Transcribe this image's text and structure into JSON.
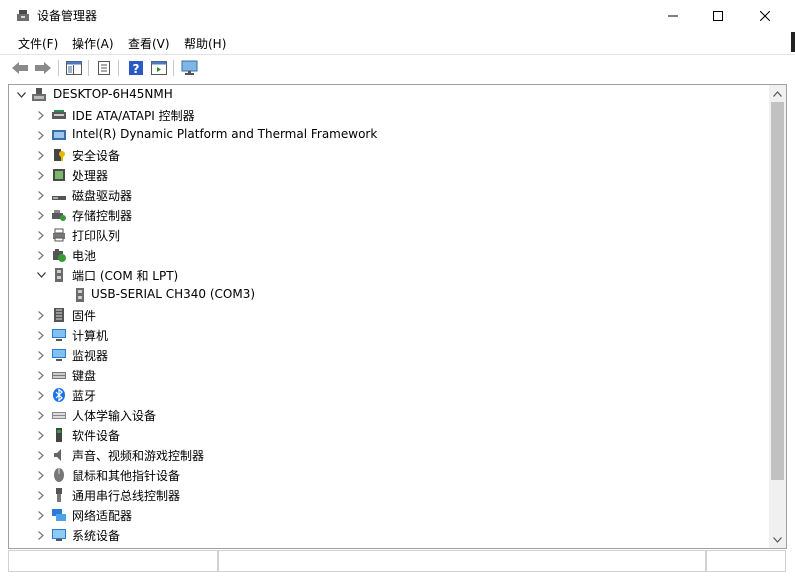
{
  "window": {
    "title": "设备管理器",
    "icon": "device-manager-icon"
  },
  "menu": [
    "文件(F)",
    "操作(A)",
    "查看(V)",
    "帮助(H)"
  ],
  "toolbar": {
    "buttons": [
      "back-icon",
      "forward-icon",
      "show-hide-console-tree-icon",
      "properties-icon",
      "help-icon",
      "action-pane-icon",
      "scan-hardware-icon"
    ]
  },
  "tree": {
    "root": "DESKTOP-6H45NMH",
    "items": [
      {
        "label": "IDE ATA/ATAPI 控制器",
        "icon": "ide-controller-icon",
        "expanded": false
      },
      {
        "label": "Intel(R) Dynamic Platform and Thermal Framework",
        "icon": "thermal-framework-icon",
        "expanded": false
      },
      {
        "label": "安全设备",
        "icon": "security-device-icon",
        "expanded": false
      },
      {
        "label": "处理器",
        "icon": "processor-icon",
        "expanded": false
      },
      {
        "label": "磁盘驱动器",
        "icon": "disk-drive-icon",
        "expanded": false
      },
      {
        "label": "存储控制器",
        "icon": "storage-controller-icon",
        "expanded": false
      },
      {
        "label": "打印队列",
        "icon": "print-queue-icon",
        "expanded": false
      },
      {
        "label": "电池",
        "icon": "battery-icon",
        "expanded": false
      },
      {
        "label": "端口 (COM 和 LPT)",
        "icon": "port-icon",
        "expanded": true
      },
      {
        "label": "USB-SERIAL CH340 (COM3)",
        "icon": "serial-port-icon",
        "child": true
      },
      {
        "label": "固件",
        "icon": "firmware-icon",
        "expanded": false
      },
      {
        "label": "计算机",
        "icon": "computer-icon",
        "expanded": false
      },
      {
        "label": "监视器",
        "icon": "monitor-icon",
        "expanded": false
      },
      {
        "label": "键盘",
        "icon": "keyboard-icon",
        "expanded": false
      },
      {
        "label": "蓝牙",
        "icon": "bluetooth-icon",
        "expanded": false
      },
      {
        "label": "人体学输入设备",
        "icon": "hid-icon",
        "expanded": false
      },
      {
        "label": "软件设备",
        "icon": "software-device-icon",
        "expanded": false
      },
      {
        "label": "声音、视频和游戏控制器",
        "icon": "sound-icon",
        "expanded": false
      },
      {
        "label": "鼠标和其他指针设备",
        "icon": "mouse-icon",
        "expanded": false
      },
      {
        "label": "通用串行总线控制器",
        "icon": "usb-controller-icon",
        "expanded": false
      },
      {
        "label": "网络适配器",
        "icon": "network-adapter-icon",
        "expanded": false
      },
      {
        "label": "系统设备",
        "icon": "system-device-icon",
        "expanded": false
      }
    ]
  },
  "colors": {
    "accent_blue": "#1e6fd6",
    "bluetooth": "#1a73e8",
    "frame_border": "#a0a0a0"
  }
}
